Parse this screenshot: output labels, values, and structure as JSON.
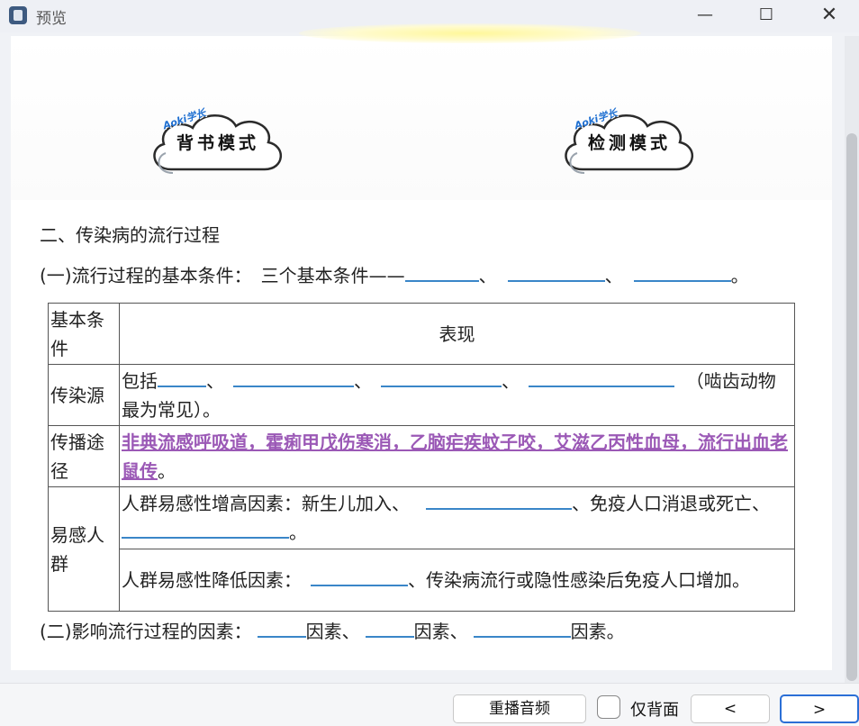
{
  "window": {
    "title": "预览",
    "minimize": "—",
    "maximize": "☐",
    "close": "✕"
  },
  "banner": {
    "left_button": {
      "tag": "Aoki学长",
      "label": "背书模式"
    },
    "right_button": {
      "tag": "Aoki学长",
      "label": "检测模式"
    }
  },
  "content": {
    "section_title": "二、传染病的流行过程",
    "line1_prefix": "(一)流行过程的基本条件：　三个基本条件——",
    "sep1": "、",
    "sep2": "、",
    "end": "。",
    "table": {
      "header_label": "基本条件",
      "header_content": "表现",
      "row1_label": "传染源",
      "row1_prefix": "包括",
      "row1_sep1": "、",
      "row1_sep2": "、",
      "row1_sep3": "、",
      "row1_suffix": "（啮齿动物最为常见）。",
      "row2_label": "传播途径",
      "row2_highlight": "非典流感呼吸道，霍痢甲戊伤寒消，乙脑疟疾蚊子咬，艾滋乙丙性血母，流行出血老鼠传",
      "row2_end": "。",
      "row3_label": "易感人群",
      "row3_prefix": "人群易感性增高因素：新生儿加入、",
      "row3_mid": "、免疫人口消退或死亡、",
      "row3_end": "。",
      "row4_prefix": "人群易感性降低因素：",
      "row4_suffix": "、传染病流行或隐性感染后免疫人口增加。"
    },
    "line2_prefix": "(二)影响流行过程的因素：",
    "line2_f1": "因素、",
    "line2_f2": "因素、",
    "line2_f3": "因素。"
  },
  "bottom": {
    "replay_label": "重播音频",
    "checkbox_label": "仅背面",
    "prev_label": "<",
    "next_label": ">"
  }
}
